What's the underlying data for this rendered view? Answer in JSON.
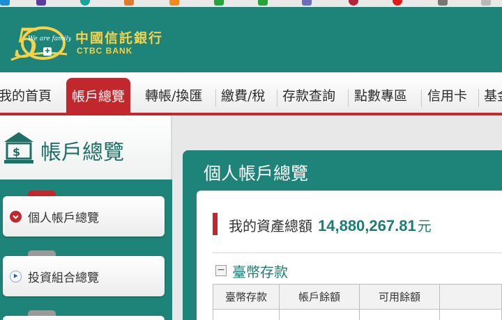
{
  "bank": {
    "name_cn": "中國信託銀行",
    "name_en": "CTBC BANK",
    "logo_text": "We are family"
  },
  "nav": {
    "items": [
      "我的首頁",
      "帳戶總覽",
      "轉帳/換匯",
      "繳費/稅",
      "存款查詢",
      "點數專區",
      "信用卡",
      "基金"
    ],
    "active": "帳戶總覽"
  },
  "sidebar": {
    "title": "帳戶總覽",
    "items": [
      {
        "label": "個人帳戶總覽",
        "active": true
      },
      {
        "label": "投資組合總覽",
        "active": false
      }
    ]
  },
  "main": {
    "panel_title": "個人帳戶總覽",
    "asset_label": "我的資產總額",
    "asset_value": "14,880,267.81",
    "asset_unit": "元",
    "section_toggle": "−",
    "section_title": "臺幣存款",
    "table_headers": [
      "臺幣存款",
      "帳戶餘額",
      "可用餘額",
      ""
    ]
  },
  "colors": {
    "brand_green": "#1e8378",
    "accent_red": "#c0282d",
    "gold": "#f4d24a"
  }
}
